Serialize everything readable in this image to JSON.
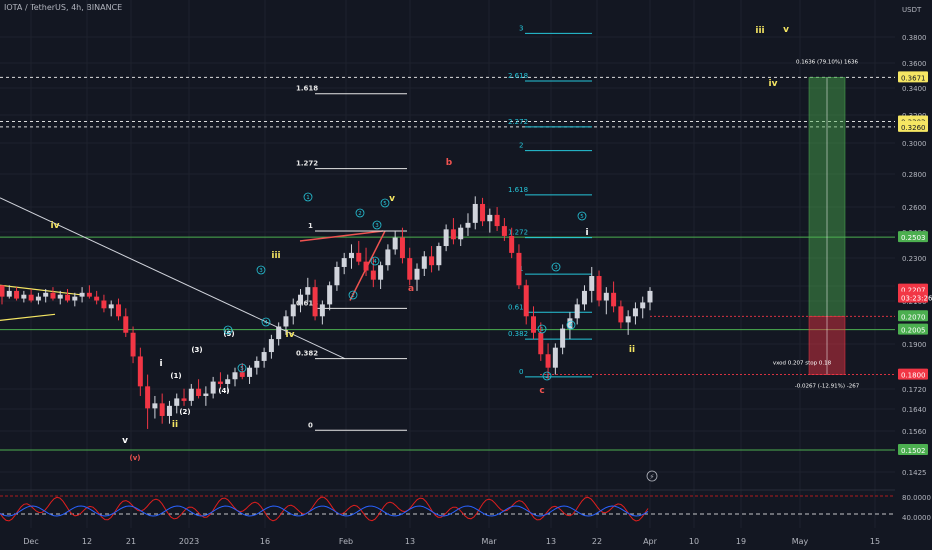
{
  "header": {
    "symbol": "IOTA / TetherUS, 4h, BINANCE",
    "currency": "USDT"
  },
  "colors": {
    "background": "#131722",
    "up_candle": "#d1d4dc",
    "down_candle": "#f23645",
    "green_line": "#4caf50",
    "fib_white": "#e6e6e6",
    "fib_cyan": "#26c6da",
    "orange_label": "#ef5350",
    "yellow_label": "#f5e663",
    "rsi_red": "#e01e1e",
    "rsi_blue": "#2962ff"
  },
  "chart_data": {
    "type": "candlestick",
    "title": "IOTA / TetherUS, 4h, BINANCE",
    "y_axis": {
      "unit": "USDT",
      "scale": "log",
      "ticks": [
        "0.3800",
        "0.3600",
        "0.3400",
        "0.3200",
        "0.3000",
        "0.2800",
        "0.2600",
        "0.2450",
        "0.2300",
        "0.2150",
        "0.2100",
        "0.1900",
        "0.1720",
        "0.1640",
        "0.1560",
        "0.1425"
      ]
    },
    "x_axis": {
      "ticks": [
        "Dec",
        "12",
        "21",
        "2023",
        "16",
        "Feb",
        "13",
        "Mar",
        "13",
        "22",
        "Apr",
        "10",
        "19",
        "May",
        "15"
      ]
    },
    "price_tags": [
      {
        "label": "0.3671",
        "value": 0.3671,
        "style": "yellow"
      },
      {
        "label": "0.3303",
        "value": 0.3303,
        "style": "yellow"
      },
      {
        "label": "0.3260",
        "value": 0.326,
        "style": "yellow"
      },
      {
        "label": "0.2503",
        "value": 0.2503,
        "style": "green"
      },
      {
        "label": "0.2207",
        "value": 0.2207,
        "style": "red"
      },
      {
        "label": "03:23:26",
        "value": 0.2165,
        "style": "red"
      },
      {
        "label": "0.2070",
        "value": 0.207,
        "style": "green"
      },
      {
        "label": "0.2005",
        "value": 0.2005,
        "style": "green"
      },
      {
        "label": "0.1800",
        "value": 0.18,
        "style": "red"
      },
      {
        "label": "0.1502",
        "value": 0.1502,
        "style": "green"
      }
    ],
    "horizontal_lines": [
      {
        "value": 0.3671,
        "style": "yellow"
      },
      {
        "value": 0.3303,
        "style": "yellow"
      },
      {
        "value": 0.326,
        "style": "yellow"
      },
      {
        "value": 0.2503,
        "style": "green"
      },
      {
        "value": 0.2005,
        "style": "green"
      },
      {
        "value": 0.1502,
        "style": "green"
      }
    ],
    "fib_white": [
      {
        "label": "1.618",
        "value": 0.353
      },
      {
        "label": "1.272",
        "value": 0.295
      },
      {
        "label": "1",
        "value": 0.254
      },
      {
        "label": "0.618",
        "value": 0.211
      },
      {
        "label": "0.382",
        "value": 0.187
      },
      {
        "label": "0",
        "value": 0.1575
      }
    ],
    "fib_cyan": [
      {
        "label": "3",
        "value": 0.408
      },
      {
        "label": "2.618",
        "value": 0.364
      },
      {
        "label": "2.272",
        "value": 0.326
      },
      {
        "label": "2",
        "value": 0.308
      },
      {
        "label": "1.618",
        "value": 0.277
      },
      {
        "label": "1.272",
        "value": 0.25
      },
      {
        "label": "1",
        "value": 0.229
      },
      {
        "label": "0.618",
        "value": 0.209
      },
      {
        "label": "0.382",
        "value": 0.196
      },
      {
        "label": "0",
        "value": 0.179
      }
    ],
    "wave_labels": [
      {
        "text": "iv",
        "style": "yellow"
      },
      {
        "text": "i",
        "style": "white"
      },
      {
        "text": "ii",
        "style": "yellow"
      },
      {
        "text": "iii",
        "style": "yellow"
      },
      {
        "text": "iv",
        "style": "yellow"
      },
      {
        "text": "v",
        "style": "yellow"
      },
      {
        "text": "iii",
        "style": "yellow"
      },
      {
        "text": "v",
        "style": "yellow"
      },
      {
        "text": "iv",
        "style": "yellow"
      },
      {
        "text": "i",
        "style": "white"
      },
      {
        "text": "ii",
        "style": "yellow"
      },
      {
        "text": "v",
        "style": "white"
      },
      {
        "text": "(v)",
        "style": "red"
      },
      {
        "text": "a",
        "style": "red"
      },
      {
        "text": "b",
        "style": "red"
      },
      {
        "text": "c",
        "style": "red"
      },
      {
        "text": "(1)",
        "style": "white"
      },
      {
        "text": "(2)",
        "style": "white"
      },
      {
        "text": "(3)",
        "style": "white"
      },
      {
        "text": "(4)",
        "style": "white"
      },
      {
        "text": "(5)",
        "style": "white"
      }
    ],
    "position": {
      "target_text": "0.1636 (79.10%) 1636",
      "stop_text": "-0.0267 (-12.91%) -267",
      "entry_text": "vxod 0.207 stop 0.18",
      "entry": 0.207,
      "stop": 0.18,
      "target": 0.3671
    },
    "rsi": {
      "levels": [
        "80.0000",
        "40.0000"
      ]
    },
    "ohlc": [
      [
        0.223,
        0.223,
        0.213,
        0.217
      ],
      [
        0.217,
        0.223,
        0.216,
        0.22
      ],
      [
        0.22,
        0.222,
        0.215,
        0.216
      ],
      [
        0.216,
        0.22,
        0.214,
        0.218
      ],
      [
        0.218,
        0.221,
        0.214,
        0.215
      ],
      [
        0.215,
        0.219,
        0.213,
        0.217
      ],
      [
        0.217,
        0.221,
        0.214,
        0.219
      ],
      [
        0.219,
        0.222,
        0.215,
        0.216
      ],
      [
        0.216,
        0.22,
        0.213,
        0.218
      ],
      [
        0.218,
        0.221,
        0.214,
        0.215
      ],
      [
        0.215,
        0.219,
        0.212,
        0.217
      ],
      [
        0.217,
        0.222,
        0.214,
        0.219
      ],
      [
        0.219,
        0.223,
        0.216,
        0.217
      ],
      [
        0.217,
        0.22,
        0.213,
        0.215
      ],
      [
        0.215,
        0.218,
        0.209,
        0.211
      ],
      [
        0.211,
        0.215,
        0.207,
        0.213
      ],
      [
        0.213,
        0.216,
        0.205,
        0.207
      ],
      [
        0.207,
        0.211,
        0.197,
        0.199
      ],
      [
        0.199,
        0.202,
        0.185,
        0.188
      ],
      [
        0.188,
        0.192,
        0.171,
        0.175
      ],
      [
        0.175,
        0.18,
        0.158,
        0.166
      ],
      [
        0.166,
        0.171,
        0.162,
        0.168
      ],
      [
        0.168,
        0.172,
        0.16,
        0.163
      ],
      [
        0.163,
        0.169,
        0.16,
        0.167
      ],
      [
        0.167,
        0.172,
        0.164,
        0.17
      ],
      [
        0.17,
        0.174,
        0.167,
        0.169
      ],
      [
        0.169,
        0.176,
        0.167,
        0.174
      ],
      [
        0.174,
        0.178,
        0.17,
        0.171
      ],
      [
        0.171,
        0.175,
        0.167,
        0.172
      ],
      [
        0.172,
        0.179,
        0.17,
        0.177
      ],
      [
        0.177,
        0.181,
        0.174,
        0.176
      ],
      [
        0.176,
        0.18,
        0.172,
        0.178
      ],
      [
        0.178,
        0.183,
        0.175,
        0.181
      ],
      [
        0.181,
        0.185,
        0.178,
        0.179
      ],
      [
        0.179,
        0.184,
        0.176,
        0.183
      ],
      [
        0.183,
        0.188,
        0.18,
        0.186
      ],
      [
        0.186,
        0.192,
        0.183,
        0.19
      ],
      [
        0.19,
        0.198,
        0.187,
        0.196
      ],
      [
        0.196,
        0.204,
        0.193,
        0.202
      ],
      [
        0.202,
        0.21,
        0.198,
        0.207
      ],
      [
        0.207,
        0.216,
        0.203,
        0.213
      ],
      [
        0.213,
        0.221,
        0.209,
        0.218
      ],
      [
        0.218,
        0.227,
        0.214,
        0.222
      ],
      [
        0.222,
        0.226,
        0.205,
        0.207
      ],
      [
        0.207,
        0.215,
        0.203,
        0.213
      ],
      [
        0.213,
        0.225,
        0.21,
        0.223
      ],
      [
        0.223,
        0.236,
        0.22,
        0.233
      ],
      [
        0.233,
        0.241,
        0.229,
        0.238
      ],
      [
        0.238,
        0.246,
        0.232,
        0.241
      ],
      [
        0.241,
        0.248,
        0.234,
        0.236
      ],
      [
        0.236,
        0.244,
        0.228,
        0.231
      ],
      [
        0.231,
        0.238,
        0.222,
        0.226
      ],
      [
        0.226,
        0.236,
        0.221,
        0.234
      ],
      [
        0.234,
        0.246,
        0.231,
        0.243
      ],
      [
        0.243,
        0.254,
        0.24,
        0.25
      ],
      [
        0.25,
        0.256,
        0.235,
        0.238
      ],
      [
        0.238,
        0.244,
        0.223,
        0.226
      ],
      [
        0.226,
        0.235,
        0.22,
        0.232
      ],
      [
        0.232,
        0.242,
        0.228,
        0.239
      ],
      [
        0.239,
        0.245,
        0.23,
        0.234
      ],
      [
        0.234,
        0.247,
        0.231,
        0.245
      ],
      [
        0.245,
        0.258,
        0.242,
        0.255
      ],
      [
        0.255,
        0.262,
        0.246,
        0.249
      ],
      [
        0.249,
        0.258,
        0.245,
        0.256
      ],
      [
        0.256,
        0.265,
        0.251,
        0.259
      ],
      [
        0.259,
        0.276,
        0.255,
        0.271
      ],
      [
        0.271,
        0.275,
        0.257,
        0.26
      ],
      [
        0.26,
        0.268,
        0.253,
        0.264
      ],
      [
        0.264,
        0.269,
        0.254,
        0.257
      ],
      [
        0.257,
        0.262,
        0.248,
        0.251
      ],
      [
        0.251,
        0.256,
        0.238,
        0.241
      ],
      [
        0.241,
        0.246,
        0.221,
        0.223
      ],
      [
        0.223,
        0.226,
        0.203,
        0.207
      ],
      [
        0.207,
        0.212,
        0.196,
        0.199
      ],
      [
        0.199,
        0.204,
        0.186,
        0.189
      ],
      [
        0.189,
        0.194,
        0.178,
        0.183
      ],
      [
        0.183,
        0.194,
        0.18,
        0.192
      ],
      [
        0.192,
        0.203,
        0.189,
        0.201
      ],
      [
        0.201,
        0.209,
        0.196,
        0.206
      ],
      [
        0.206,
        0.216,
        0.203,
        0.213
      ],
      [
        0.213,
        0.223,
        0.21,
        0.22
      ],
      [
        0.22,
        0.233,
        0.214,
        0.228
      ],
      [
        0.228,
        0.231,
        0.212,
        0.215
      ],
      [
        0.215,
        0.222,
        0.208,
        0.219
      ],
      [
        0.219,
        0.225,
        0.209,
        0.212
      ],
      [
        0.212,
        0.215,
        0.201,
        0.204
      ],
      [
        0.204,
        0.21,
        0.198,
        0.207
      ],
      [
        0.207,
        0.214,
        0.203,
        0.211
      ],
      [
        0.211,
        0.217,
        0.206,
        0.214
      ],
      [
        0.214,
        0.222,
        0.21,
        0.22
      ]
    ]
  }
}
